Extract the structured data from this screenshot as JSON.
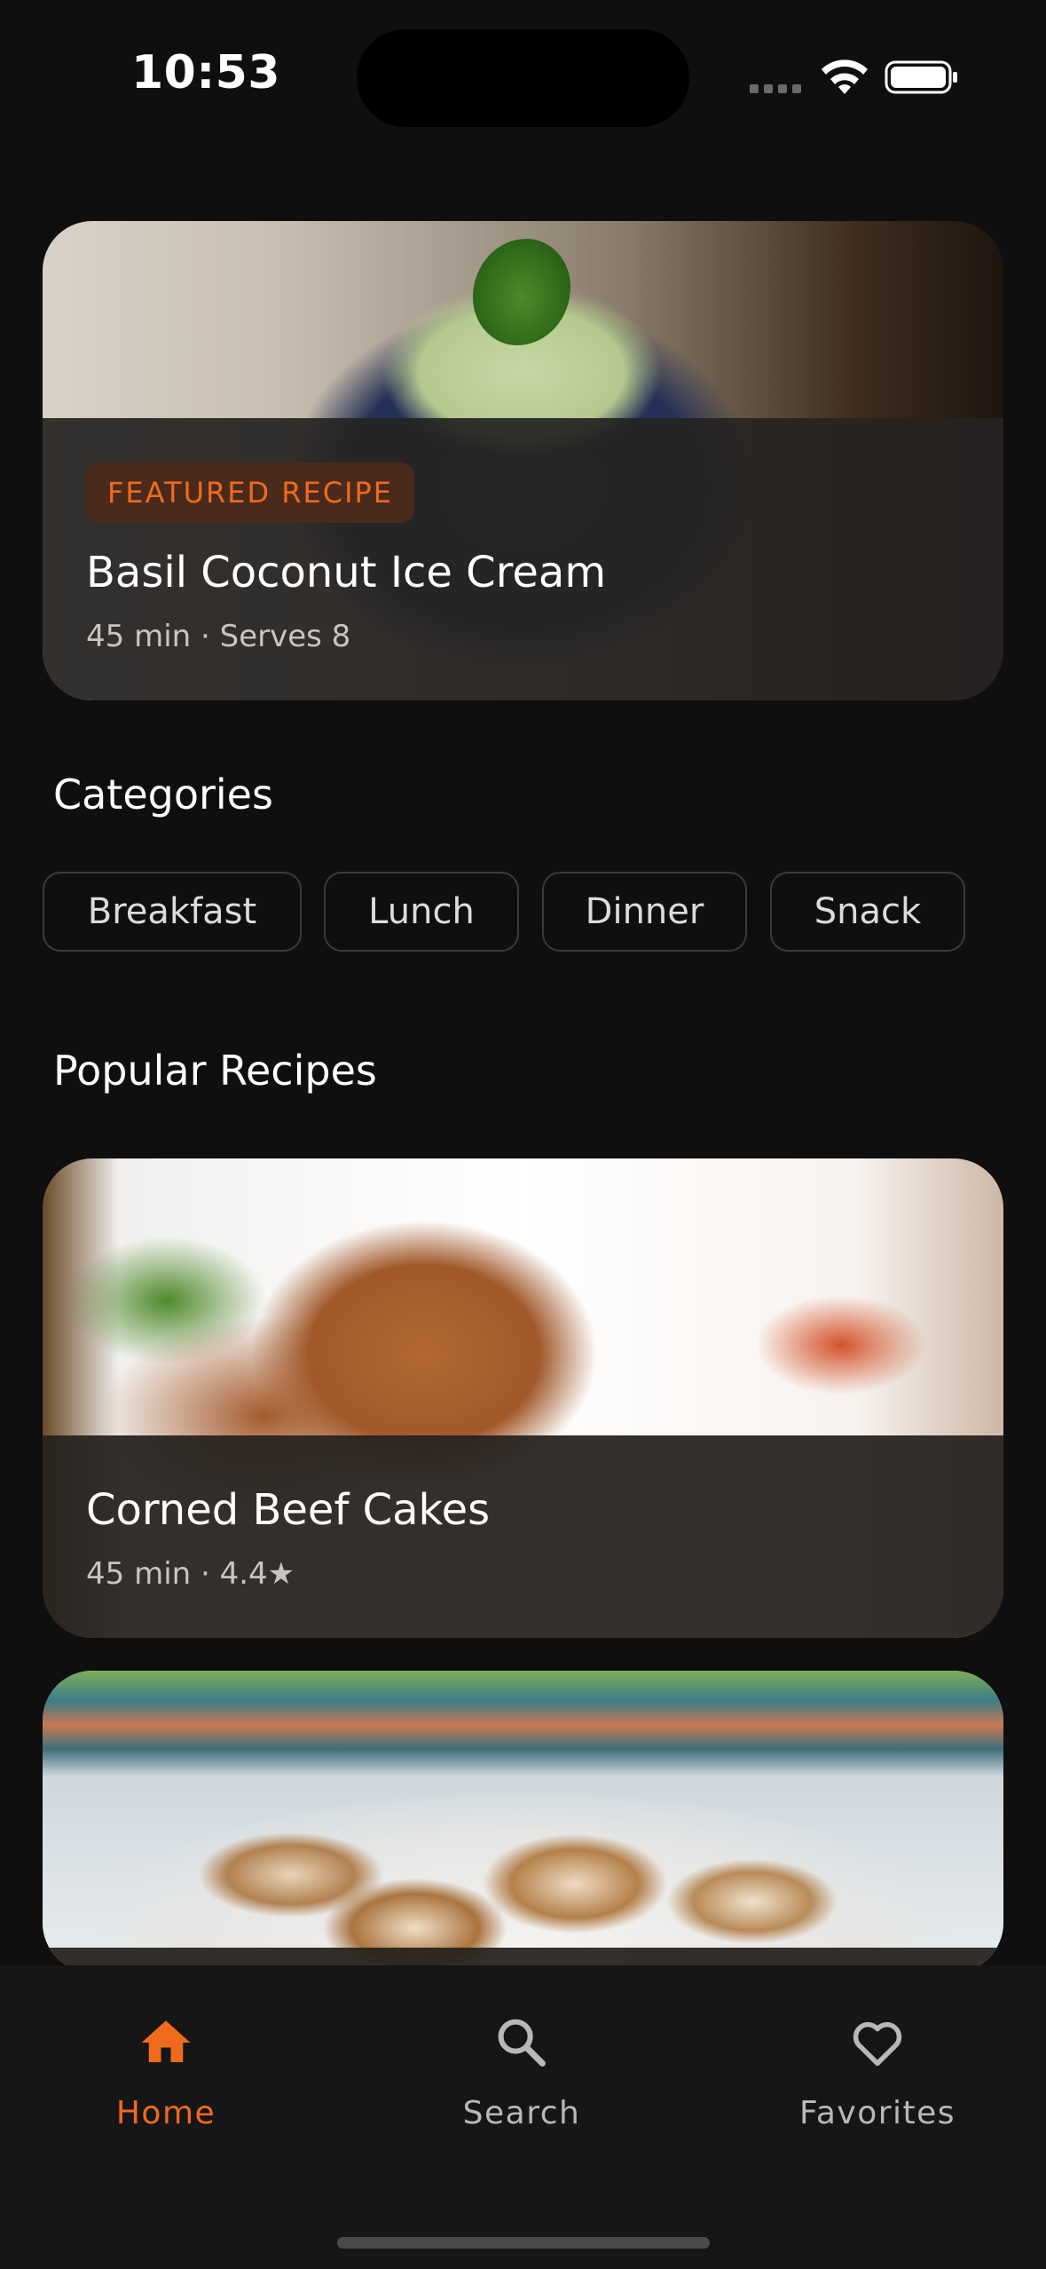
{
  "status_bar": {
    "time": "10:53"
  },
  "featured": {
    "badge": "FEATURED RECIPE",
    "title": "Basil Coconut Ice Cream",
    "meta": "45 min · Serves 8"
  },
  "categories": {
    "title": "Categories",
    "items": [
      "Breakfast",
      "Lunch",
      "Dinner",
      "Snack"
    ]
  },
  "popular": {
    "title": "Popular Recipes",
    "recipes": [
      {
        "title": "Corned Beef Cakes",
        "meta": "45 min · 4.4★"
      }
    ]
  },
  "tab_bar": {
    "tabs": [
      {
        "label": "Home",
        "icon": "home-icon",
        "active": true
      },
      {
        "label": "Search",
        "icon": "search-icon",
        "active": false
      },
      {
        "label": "Favorites",
        "icon": "heart-icon",
        "active": false
      }
    ]
  },
  "colors": {
    "background": "#0f0f0f",
    "accent": "#f06a1c",
    "tab_inactive": "#b8b8b8"
  }
}
